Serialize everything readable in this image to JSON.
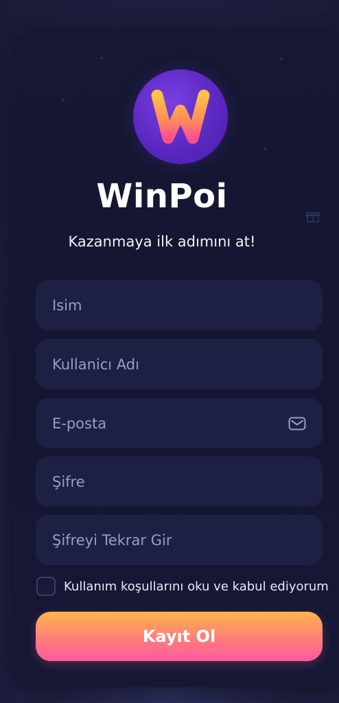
{
  "app": {
    "name": "WinPoi",
    "logo_letter": "W",
    "tagline": "Kazanmaya ilk adımını at!"
  },
  "form": {
    "name_placeholder": "Isim",
    "username_placeholder": "Kullanicı Adı",
    "email_placeholder": "E-posta",
    "password_placeholder": "Şifre",
    "password_repeat_placeholder": "Şifreyi Tekrar Gir",
    "terms_label": "Kullanım koşullarını oku ve kabul ediyorum",
    "terms_checked": false,
    "submit_label": "Kayıt Ol"
  },
  "icons": {
    "logo": "winpoi-logo-icon",
    "email": "mail-icon",
    "decoration": "gift-icon"
  },
  "colors": {
    "background": "#1e1f3d",
    "card": "#151733",
    "field": "#1d2043",
    "placeholder": "#9a9cc4",
    "logo_purple": "#5a28c2",
    "button_top": "#ffb54b",
    "button_bottom": "#ff5aa0"
  }
}
